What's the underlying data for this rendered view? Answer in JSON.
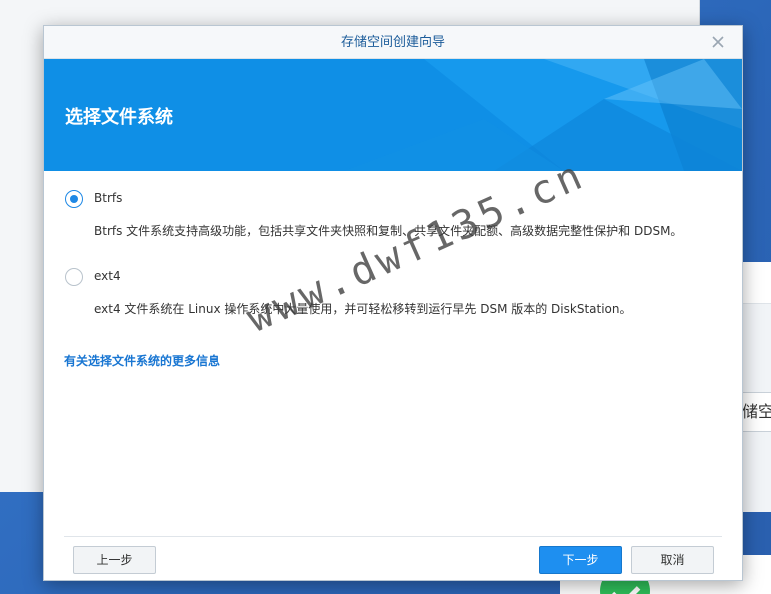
{
  "background": {
    "right_partial_text": "储空间"
  },
  "dialog": {
    "title": "存储空间创建向导",
    "banner_title": "选择文件系统",
    "options": [
      {
        "label": "Btrfs",
        "description": "Btrfs 文件系统支持高级功能，包括共享文件夹快照和复制、共享文件夹配额、高级数据完整性保护和 DDSM。",
        "selected": true
      },
      {
        "label": "ext4",
        "description": "ext4 文件系统在 Linux 操作系统中大量使用，并可轻松移转到运行早先 DSM 版本的 DiskStation。",
        "selected": false
      }
    ],
    "more_info_link": "有关选择文件系统的更多信息",
    "buttons": {
      "back": "上一步",
      "next": "下一步",
      "cancel": "取消"
    }
  },
  "watermark": "www.dwf135.cn",
  "colors": {
    "banner": "#0f8fe6",
    "accent": "#1e88e5",
    "link": "#1976d2",
    "primary_button": "#1e8ff0"
  }
}
